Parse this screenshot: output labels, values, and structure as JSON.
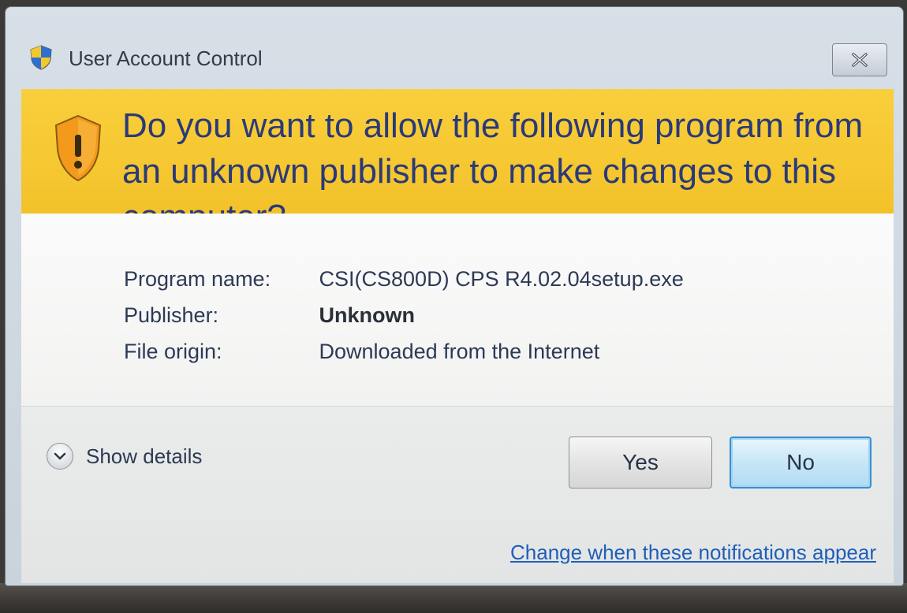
{
  "window": {
    "title": "User Account Control",
    "close_icon": "close-icon"
  },
  "banner": {
    "question": "Do you want to allow the following program from an unknown publisher to make changes to this computer?",
    "icon": "warning-shield-icon",
    "color": "#f6c52d"
  },
  "details": {
    "program_name_label": "Program name:",
    "program_name_value": "CSI(CS800D) CPS R4.02.04setup.exe",
    "publisher_label": "Publisher:",
    "publisher_value": "Unknown",
    "file_origin_label": "File origin:",
    "file_origin_value": "Downloaded from the Internet"
  },
  "footer": {
    "show_details_label": "Show details",
    "yes_label": "Yes",
    "no_label": "No",
    "notifications_link": "Change when these notifications appear",
    "link_color": "#1f5fb8"
  }
}
